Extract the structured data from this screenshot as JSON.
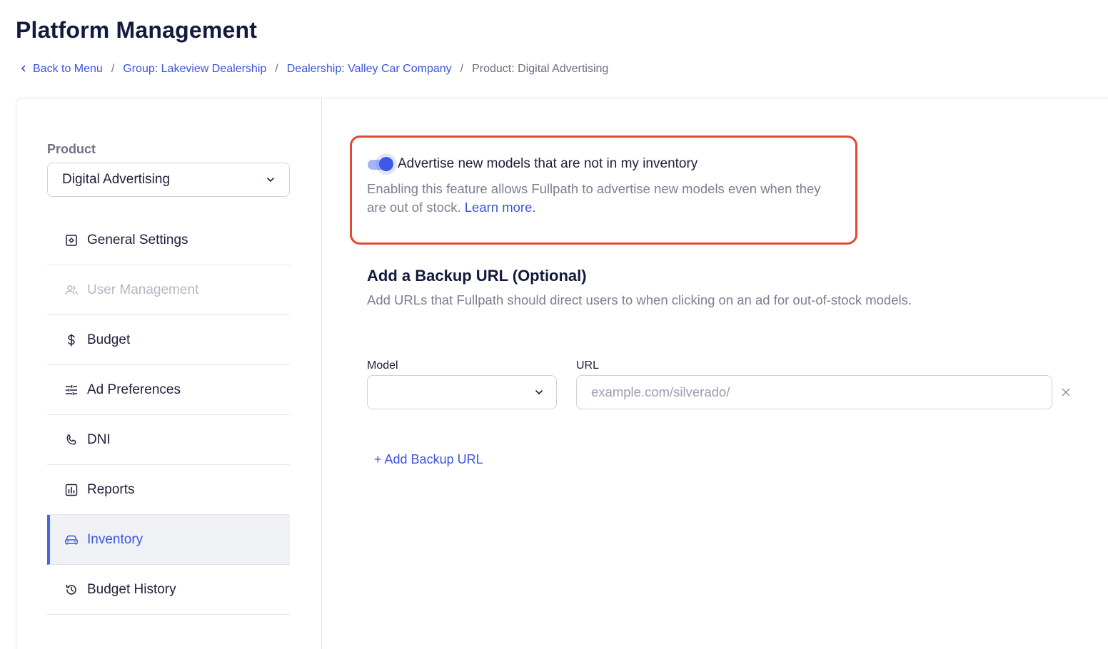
{
  "header": {
    "title": "Platform Management"
  },
  "breadcrumb": {
    "back": "Back to Menu",
    "group": "Group: Lakeview Dealership",
    "dealership": "Dealership: Valley Car Company",
    "current": "Product: Digital Advertising",
    "separator": "/"
  },
  "sidebar": {
    "product_label": "Product",
    "product_value": "Digital Advertising",
    "items": [
      {
        "label": "General Settings",
        "icon": "settings-icon"
      },
      {
        "label": "User Management",
        "icon": "users-icon",
        "disabled": true
      },
      {
        "label": "Budget",
        "icon": "dollar-icon"
      },
      {
        "label": "Ad Preferences",
        "icon": "sliders-icon"
      },
      {
        "label": "DNI",
        "icon": "phone-icon"
      },
      {
        "label": "Reports",
        "icon": "bar-chart-icon"
      },
      {
        "label": "Inventory",
        "icon": "car-icon",
        "active": true
      },
      {
        "label": "Budget History",
        "icon": "history-icon"
      }
    ]
  },
  "main": {
    "toggle": {
      "on": true,
      "label": "Advertise new models that are not in my inventory",
      "description": "Enabling this feature allows Fullpath to advertise new models even when they are out of stock.",
      "learn_more": "Learn more."
    },
    "backup": {
      "title": "Add a Backup URL (Optional)",
      "description": "Add URLs that Fullpath should direct users to when clicking on an ad for out-of-stock models.",
      "model_label": "Model",
      "model_value": "",
      "url_label": "URL",
      "url_placeholder": "example.com/silverado/",
      "url_value": "",
      "add_label": "+ Add Backup URL"
    }
  },
  "colors": {
    "accent": "#3a55e0",
    "highlight": "#e04a2f",
    "active_bg": "#f0f1f4"
  }
}
